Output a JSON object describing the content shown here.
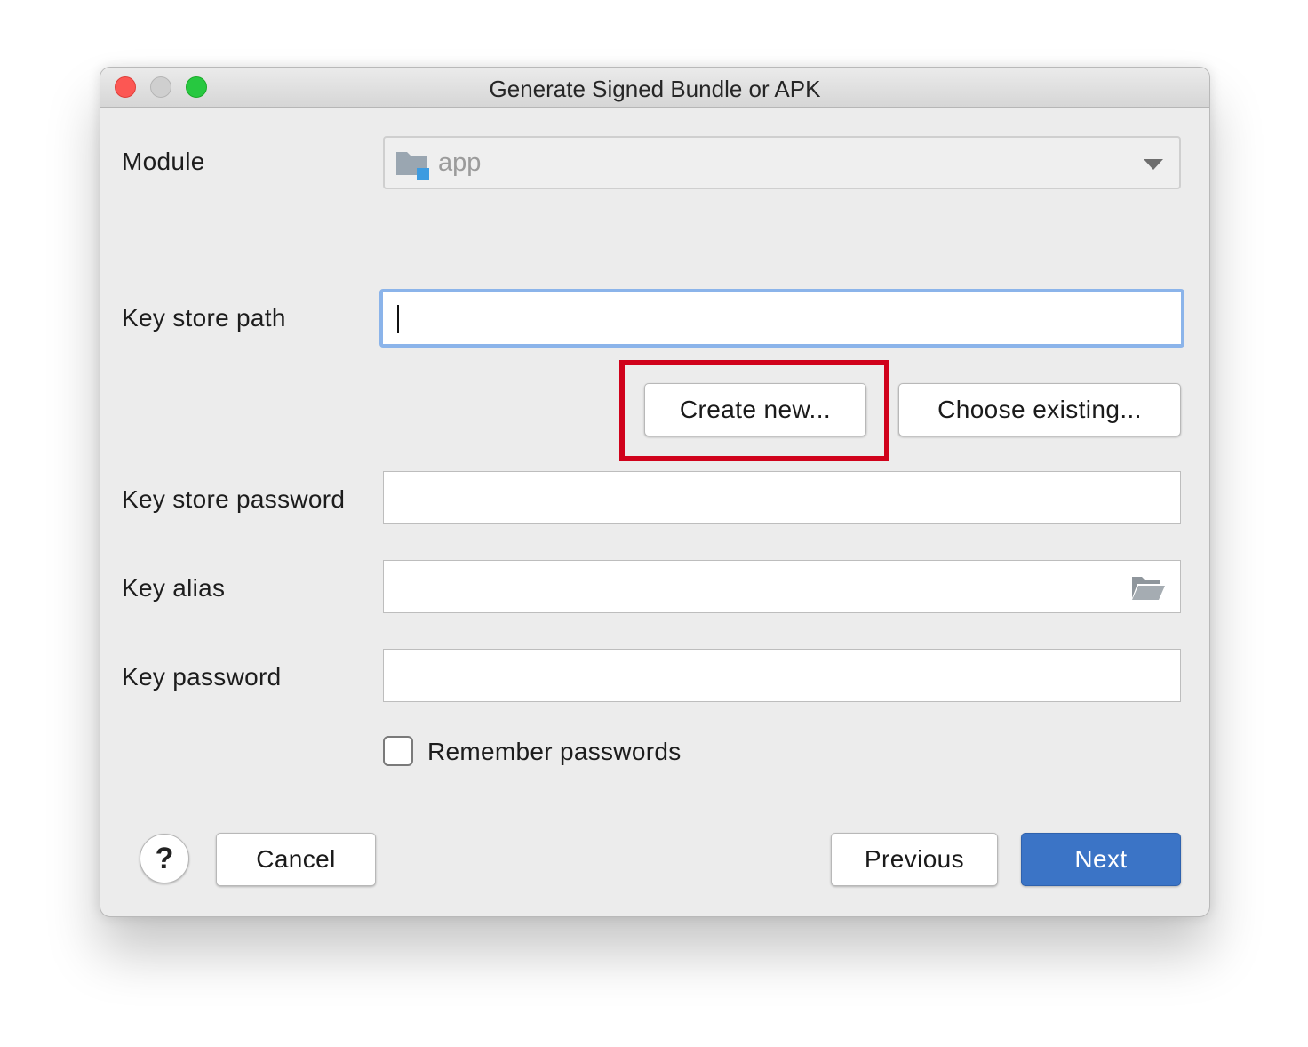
{
  "window": {
    "title": "Generate Signed Bundle or APK"
  },
  "module": {
    "label": "Module",
    "value": "app",
    "icon": "module-folder-icon"
  },
  "key_store_path": {
    "label": "Key store path",
    "value": ""
  },
  "key_store_actions": {
    "create_label": "Create new...",
    "choose_label": "Choose existing..."
  },
  "key_store_password": {
    "label": "Key store password",
    "value": ""
  },
  "key_alias": {
    "label": "Key alias",
    "value": "",
    "icon": "folder-open-icon"
  },
  "key_password": {
    "label": "Key password",
    "value": ""
  },
  "remember": {
    "label": "Remember passwords",
    "checked": false
  },
  "footer": {
    "help_label": "?",
    "cancel_label": "Cancel",
    "previous_label": "Previous",
    "next_label": "Next"
  },
  "colors": {
    "highlight": "#d0021b",
    "primary": "#3b74c6",
    "focus_ring": "#8bb4ea"
  }
}
